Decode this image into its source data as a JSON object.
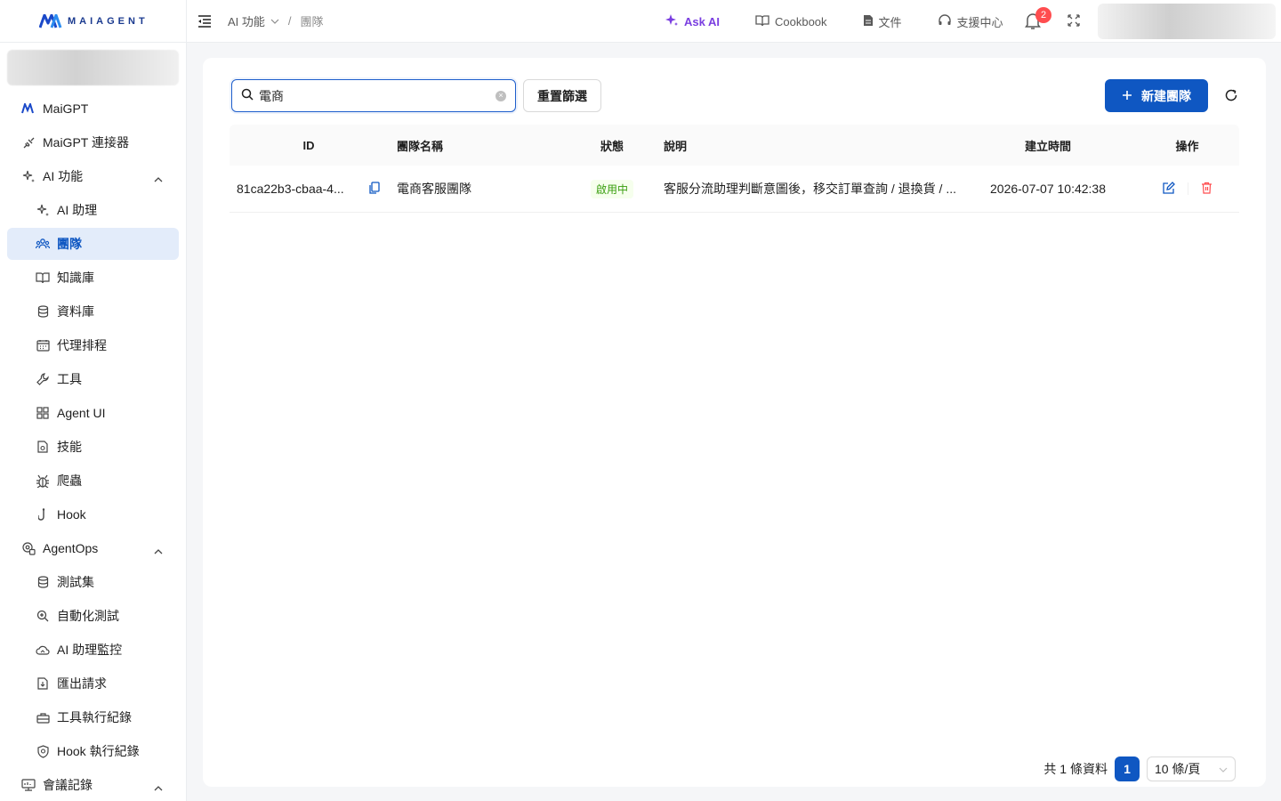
{
  "brand": {
    "logo_text": "MAIAGENT"
  },
  "sidebar": {
    "items": [
      {
        "label": "MaiGPT",
        "icon": "maigpt-logo-icon",
        "level": 0
      },
      {
        "label": "MaiGPT 連接器",
        "icon": "connector-icon",
        "level": 0
      },
      {
        "label": "AI 功能",
        "icon": "sparkle-icon",
        "level": 0,
        "expanded": true
      },
      {
        "label": "AI 助理",
        "icon": "sparkle-icon",
        "level": 1
      },
      {
        "label": "團隊",
        "icon": "team-icon",
        "level": 1,
        "active": true
      },
      {
        "label": "知識庫",
        "icon": "book-icon",
        "level": 1
      },
      {
        "label": "資料庫",
        "icon": "database-icon",
        "level": 1
      },
      {
        "label": "代理排程",
        "icon": "calendar-icon",
        "level": 1
      },
      {
        "label": "工具",
        "icon": "wrench-icon",
        "level": 1
      },
      {
        "label": "Agent UI",
        "icon": "grid-icon",
        "level": 1
      },
      {
        "label": "技能",
        "icon": "file-icon",
        "level": 1
      },
      {
        "label": "爬蟲",
        "icon": "bug-icon",
        "level": 1
      },
      {
        "label": "Hook",
        "icon": "hook-icon",
        "level": 1
      },
      {
        "label": "AgentOps",
        "icon": "agentops-icon",
        "level": 0,
        "expanded": true
      },
      {
        "label": "測試集",
        "icon": "database-icon",
        "level": 1
      },
      {
        "label": "自動化測試",
        "icon": "search-zoom-icon",
        "level": 1
      },
      {
        "label": "AI 助理監控",
        "icon": "cloud-icon",
        "level": 1
      },
      {
        "label": "匯出請求",
        "icon": "export-file-icon",
        "level": 1
      },
      {
        "label": "工具執行紀錄",
        "icon": "toolbox-icon",
        "level": 1
      },
      {
        "label": "Hook 執行紀錄",
        "icon": "shield-icon",
        "level": 1
      },
      {
        "label": "會議記錄",
        "icon": "meeting-icon",
        "level": 0,
        "expanded": true
      }
    ]
  },
  "header": {
    "breadcrumb": {
      "parent": "AI 功能",
      "current": "團隊"
    },
    "ask_ai": "Ask AI",
    "cookbook": "Cookbook",
    "docs": "文件",
    "support": "支援中心",
    "notification_count": "2"
  },
  "toolbar": {
    "search_value": "電商",
    "reset_label": "重置篩選",
    "new_label": "新建團隊"
  },
  "table": {
    "headers": {
      "id": "ID",
      "name": "團隊名稱",
      "status": "狀態",
      "description": "說明",
      "created": "建立時間",
      "actions": "操作"
    },
    "rows": [
      {
        "id": "81ca22b3-cbaa-4...",
        "name": "電商客服團隊",
        "status": "啟用中",
        "description": "客服分流助理判斷意圖後，移交訂單查詢 / 退換貨 / ...",
        "created": "2026-07-07 10:42:38"
      }
    ]
  },
  "pagination": {
    "total_label": "共 1 條資料",
    "current_page": "1",
    "page_size": "10 條/頁"
  },
  "colors": {
    "primary": "#0f57c2",
    "ask_ai": "#7a3ee0",
    "status_green": "#389e0d",
    "danger": "#ff4d4f"
  }
}
